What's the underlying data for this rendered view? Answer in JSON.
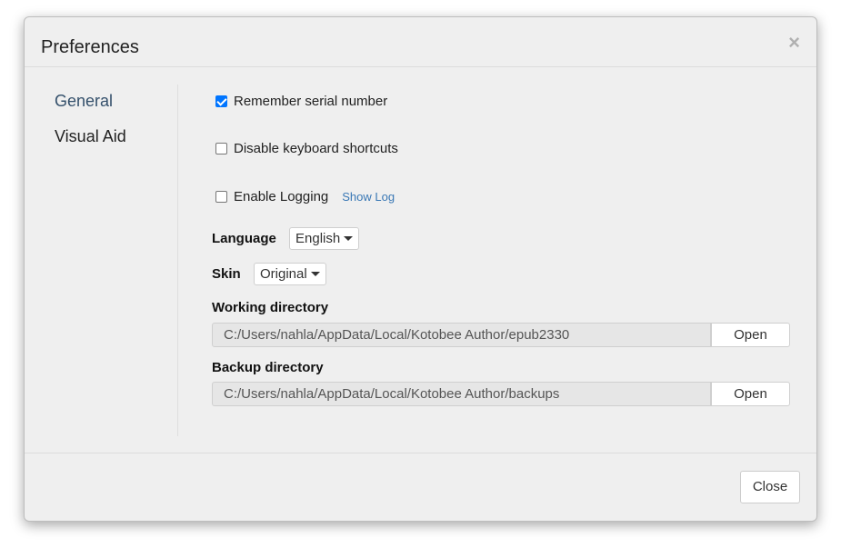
{
  "dialog": {
    "title": "Preferences",
    "close_icon": "×"
  },
  "sidebar": {
    "items": [
      {
        "label": "General",
        "active": true
      },
      {
        "label": "Visual Aid",
        "active": false
      }
    ]
  },
  "general": {
    "remember_serial": {
      "label": "Remember serial number",
      "checked": true
    },
    "disable_shortcuts": {
      "label": "Disable keyboard shortcuts",
      "checked": false
    },
    "enable_logging": {
      "label": "Enable Logging",
      "checked": false
    },
    "show_log_label": "Show Log",
    "language": {
      "label": "Language",
      "value": "English"
    },
    "skin": {
      "label": "Skin",
      "value": "Original"
    },
    "working_directory": {
      "label": "Working directory",
      "value": "C:/Users/nahla/AppData/Local/Kotobee Author/epub2330",
      "button": "Open"
    },
    "backup_directory": {
      "label": "Backup directory",
      "value": "C:/Users/nahla/AppData/Local/Kotobee Author/backups",
      "button": "Open"
    }
  },
  "footer": {
    "close_label": "Close"
  },
  "colors": {
    "accent": "#0075ff",
    "link": "#3a78b5",
    "active_nav": "#34506b"
  }
}
